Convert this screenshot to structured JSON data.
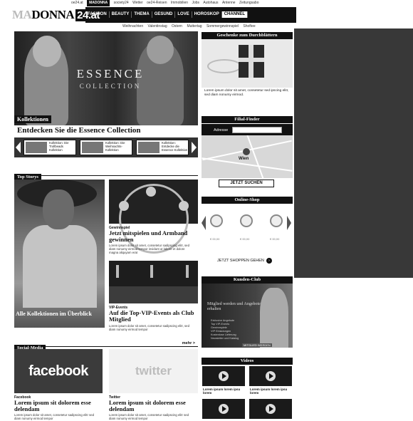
{
  "topbar": {
    "items": [
      "oe24.at",
      "MADONNA",
      "society24",
      "Wetter",
      "oe24-Reisen",
      "Immobilien",
      "Jobs",
      "Autohaus",
      "Antenne",
      "Zeitungsabo"
    ]
  },
  "logo": {
    "part1": "MA",
    "part2": "DONNA",
    "part3": "24.at"
  },
  "mainnav": {
    "items": [
      "FASHION",
      "BEAUTY",
      "THEMA",
      "GESUND",
      "LOVE",
      "HOROSKOP",
      "CHANNEL"
    ]
  },
  "subnav": {
    "items": [
      "Weihnachten",
      "Valentinstag",
      "Ostern",
      "Muttertag",
      "Sommergewinnspiel",
      "Shoftee"
    ]
  },
  "hero": {
    "title": "ESSENCE",
    "subtitle": "COLLECTION",
    "badge": "Kollektionen",
    "headline": "Entdecken Sie die Essence Collection"
  },
  "carousel": {
    "items": [
      {
        "text": "Kollektion: Die Trollbeads Kollektion"
      },
      {
        "text": "Kollektion: Die Weihnachts-Kollektion"
      },
      {
        "text": "Kollektion: Entdecke die Essence Kollektion"
      }
    ]
  },
  "topstorys": {
    "title": "Top Storys",
    "left_caption": "Alle Kollektionen im Überblick",
    "story1": {
      "category": "Gewinnspiel",
      "headline": "Jetzt mitspielen und Armband gewinnen",
      "body": "Lorem ipsum dolor sit amet, consetetur sadipscing elitr, sed diam nonumy eirmod tempor invidunt ut labore et dolore magna aliquyam erat"
    },
    "story2": {
      "category": "VIP-Events",
      "headline": "Auf die Top-VIP-Events als Club Mitglied",
      "body": "Lorem ipsum dolor sit amet, consetetur sadipscing elitr, sed diam nonumy eirmod tempor"
    }
  },
  "social": {
    "title": "Social-Media",
    "more": "mehr >",
    "facebook": {
      "logo": "facebook",
      "category": "Facebook",
      "headline": "Lorem ipsum sit dolorem esse delendam",
      "body": "Lorem ipsum dolor sit amet, consetetur sadipscing elitr sed diam nonumy eirmod tempor"
    },
    "twitter": {
      "logo": "twitter",
      "category": "Twitter",
      "headline": "Lorem ipsum sit dolorem esse delendam",
      "body": "Lorem ipsum dolor sit amet, consetetur sadipscing elitr sed diam nonumy eirmod tempor"
    }
  },
  "right": {
    "gift_title": "Geschenke zum Durchblättern",
    "gift_text": "Lorem ipsum dolor sit amet, consetetur sed ipscing elitr, sed diam nonumy eirmod.",
    "finder_title": "Filial-Finder",
    "finder_label": "Adresse",
    "finder_city": "Wien",
    "finder_button": "JETZT SUCHEN",
    "shop_title": "Online-Shop",
    "shop_prices": [
      "€ 00,00",
      "€ 00,00",
      "€ 00,00"
    ],
    "shop_button": "JETZT SHOPPEN GEHEN",
    "club_title": "Kunden-Club",
    "club_headline": "Mitglied werden und Angebote erhalten",
    "club_list": [
      "Exklusive Angebote",
      "Top VIP-Events",
      "Gewinnspiele",
      "VIP Einladungen",
      "Kostenlose Lieferung",
      "Newsletter und Katalog"
    ],
    "club_button": "MITGLIED WERDEN",
    "videos_title": "Videos",
    "videos": [
      {
        "caption": "Lorem ipsum lorem ipsu lorem"
      },
      {
        "caption": "Lorem ipsum lorem ipsu lorem"
      }
    ]
  }
}
